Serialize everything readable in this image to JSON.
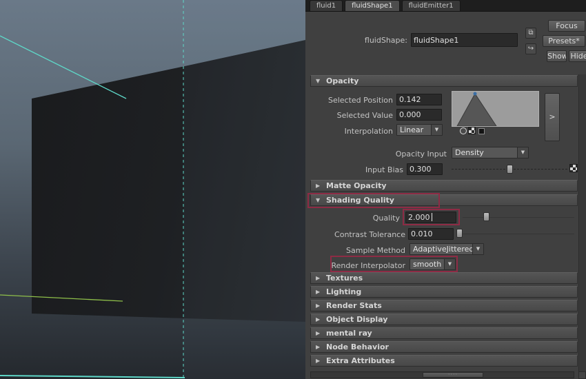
{
  "tabs": {
    "tab1": "fluid1",
    "tab2": "fluidShape1",
    "tab3": "fluidEmitter1"
  },
  "header": {
    "type_label": "fluidShape:",
    "name_value": "fluidShape1",
    "focus": "Focus",
    "presets": "Presets*",
    "show": "Show",
    "hide": "Hide"
  },
  "opacity": {
    "title": "Opacity",
    "selected_position_label": "Selected Position",
    "selected_position": "0.142",
    "selected_value_label": "Selected Value",
    "selected_value": "0.000",
    "interpolation_label": "Interpolation",
    "interpolation": "Linear",
    "expand_button": ">",
    "opacity_input_label": "Opacity Input",
    "opacity_input": "Density",
    "input_bias_label": "Input Bias",
    "input_bias": "0.300"
  },
  "matte_opacity": {
    "title": "Matte Opacity"
  },
  "shading_quality": {
    "title": "Shading Quality",
    "quality_label": "Quality",
    "quality": "2.000",
    "contrast_tolerance_label": "Contrast Tolerance",
    "contrast_tolerance": "0.010",
    "sample_method_label": "Sample Method",
    "sample_method": "AdaptiveJittered",
    "render_interpolator_label": "Render Interpolator",
    "render_interpolator": "smooth"
  },
  "collapsed_sections": [
    "Textures",
    "Lighting",
    "Render Stats",
    "Object Display",
    "mental ray",
    "Node Behavior",
    "Extra Attributes"
  ],
  "scrollbar_dots": "····",
  "colors": {
    "annotation_highlight": "#8e2b45",
    "wire_cyan": "#5ed8c8",
    "wire_green": "#8fc04a",
    "panel_bg": "#404040"
  }
}
